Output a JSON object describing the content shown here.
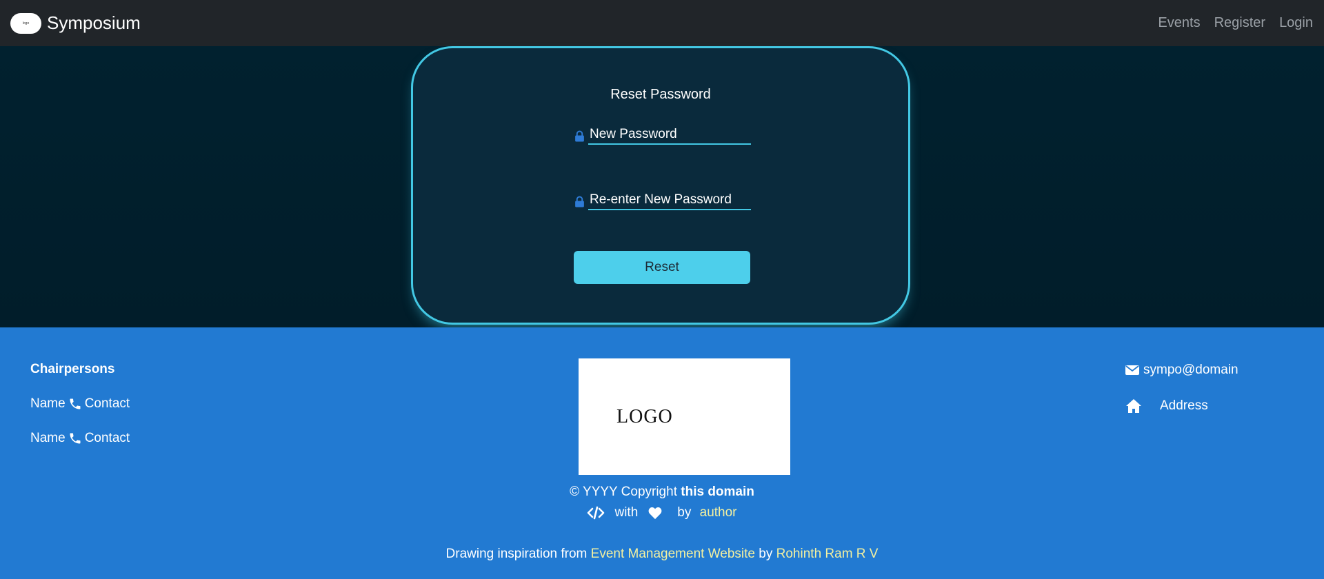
{
  "navbar": {
    "brand_logo_text": "logo",
    "brand_name": "Symposium",
    "links": [
      "Events",
      "Register",
      "Login"
    ]
  },
  "form": {
    "title": "Reset Password",
    "new_password_placeholder": "New Password",
    "reenter_password_placeholder": "Re-enter New Password",
    "submit_label": "Reset"
  },
  "footer": {
    "chairpersons_title": "Chairpersons",
    "chairpersons": [
      {
        "name": "Name",
        "contact": "Contact"
      },
      {
        "name": "Name",
        "contact": "Contact"
      }
    ],
    "logo_text": "LOGO",
    "copyright_prefix": "© YYYY Copyright",
    "copyright_domain": "this domain",
    "made_with": "with",
    "by": "by",
    "author": "author",
    "inspiration_prefix": "Drawing inspiration from",
    "inspiration_project": "Event Management Website",
    "inspiration_by": "by",
    "inspiration_author": "Rohinth Ram R V",
    "email": "sympo@domain",
    "address": "Address"
  },
  "colors": {
    "navbar_bg": "#212529",
    "main_bg": "#01202e",
    "accent": "#43c8e4",
    "footer_bg": "#227ad2",
    "lock_icon": "#2e7bd6",
    "link_highlight": "#f4f1a0"
  }
}
